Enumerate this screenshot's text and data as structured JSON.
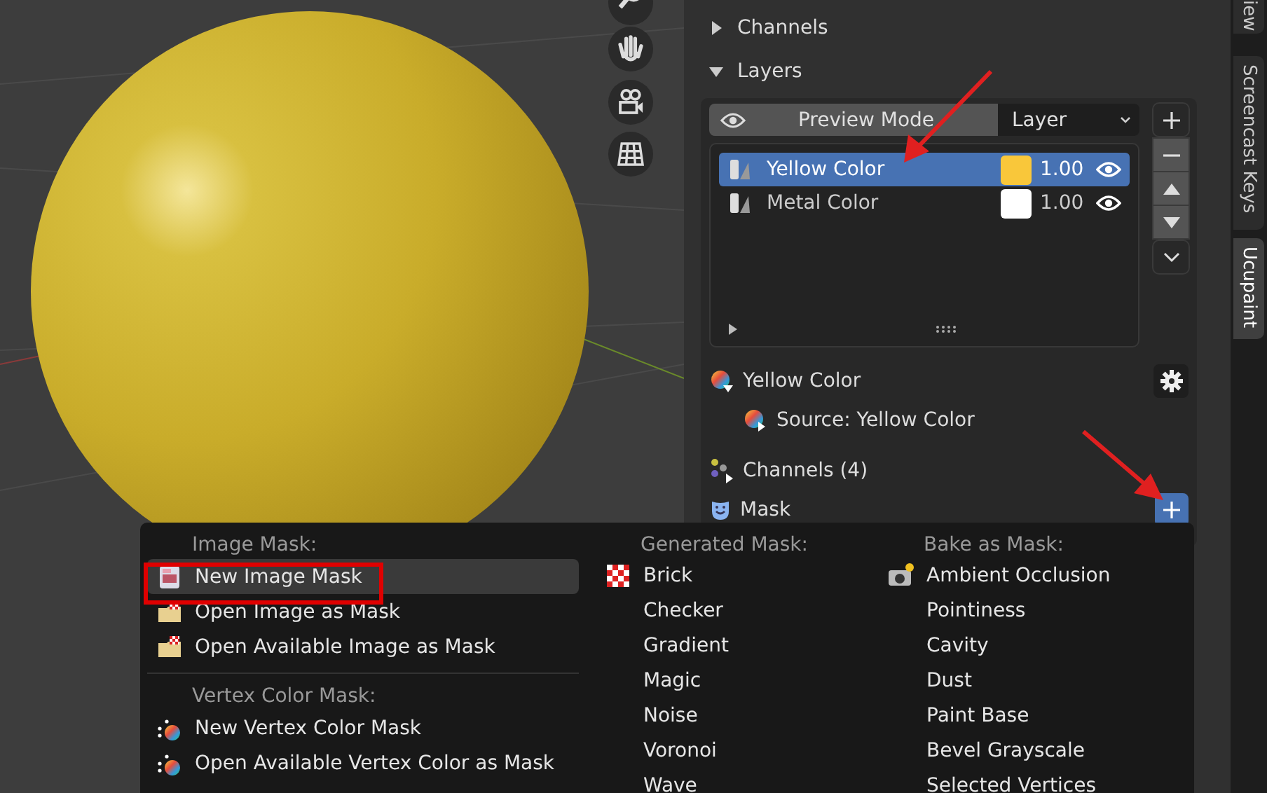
{
  "panel": {
    "sections": [
      {
        "label": "Channels",
        "expanded": false
      },
      {
        "label": "Layers",
        "expanded": true
      }
    ],
    "preview_mode": "Preview Mode",
    "layer_type": "Layer",
    "layers": [
      {
        "name": "Yellow Color",
        "color": "#f9c73a",
        "opacity": "1.00",
        "selected": true
      },
      {
        "name": "Metal Color",
        "color": "#ffffff",
        "opacity": "1.00",
        "selected": false
      }
    ],
    "active_layer": "Yellow Color",
    "source": "Source: Yellow Color",
    "channels": "Channels (4)",
    "mask": "Mask"
  },
  "side_tabs": [
    {
      "label": "iew",
      "selected": false
    },
    {
      "label": "Screencast Keys",
      "selected": false
    },
    {
      "label": "Ucupaint",
      "selected": true
    }
  ],
  "menu": {
    "columns": [
      {
        "groups": [
          {
            "heading": "Image Mask:",
            "items": [
              {
                "label": "New Image Mask",
                "kind": "new-image",
                "selected": true
              },
              {
                "label": "Open Image as Mask",
                "kind": "open-image",
                "selected": false
              },
              {
                "label": "Open Available Image as Mask",
                "kind": "open-image",
                "selected": false
              }
            ]
          },
          {
            "heading": "Vertex Color Mask:",
            "items": [
              {
                "label": "New Vertex Color Mask",
                "kind": "vertex",
                "selected": false
              },
              {
                "label": "Open Available Vertex Color as Mask",
                "kind": "vertex",
                "selected": false
              }
            ]
          }
        ]
      },
      {
        "groups": [
          {
            "heading": "Generated Mask:",
            "items": [
              {
                "label": "Brick",
                "kind": "checker",
                "selected": false
              },
              {
                "label": "Checker",
                "kind": "plain",
                "selected": false
              },
              {
                "label": "Gradient",
                "kind": "plain",
                "selected": false
              },
              {
                "label": "Magic",
                "kind": "plain",
                "selected": false
              },
              {
                "label": "Noise",
                "kind": "plain",
                "selected": false
              },
              {
                "label": "Voronoi",
                "kind": "plain",
                "selected": false
              },
              {
                "label": "Wave",
                "kind": "plain",
                "selected": false
              }
            ]
          }
        ]
      },
      {
        "groups": [
          {
            "heading": "Bake as Mask:",
            "items": [
              {
                "label": "Ambient Occlusion",
                "kind": "camera",
                "selected": false
              },
              {
                "label": "Pointiness",
                "kind": "plain",
                "selected": false
              },
              {
                "label": "Cavity",
                "kind": "plain",
                "selected": false
              },
              {
                "label": "Dust",
                "kind": "plain",
                "selected": false
              },
              {
                "label": "Paint Base",
                "kind": "plain",
                "selected": false
              },
              {
                "label": "Bevel Grayscale",
                "kind": "plain",
                "selected": false
              },
              {
                "label": "Selected Vertices",
                "kind": "plain",
                "selected": false
              }
            ]
          }
        ]
      }
    ]
  }
}
